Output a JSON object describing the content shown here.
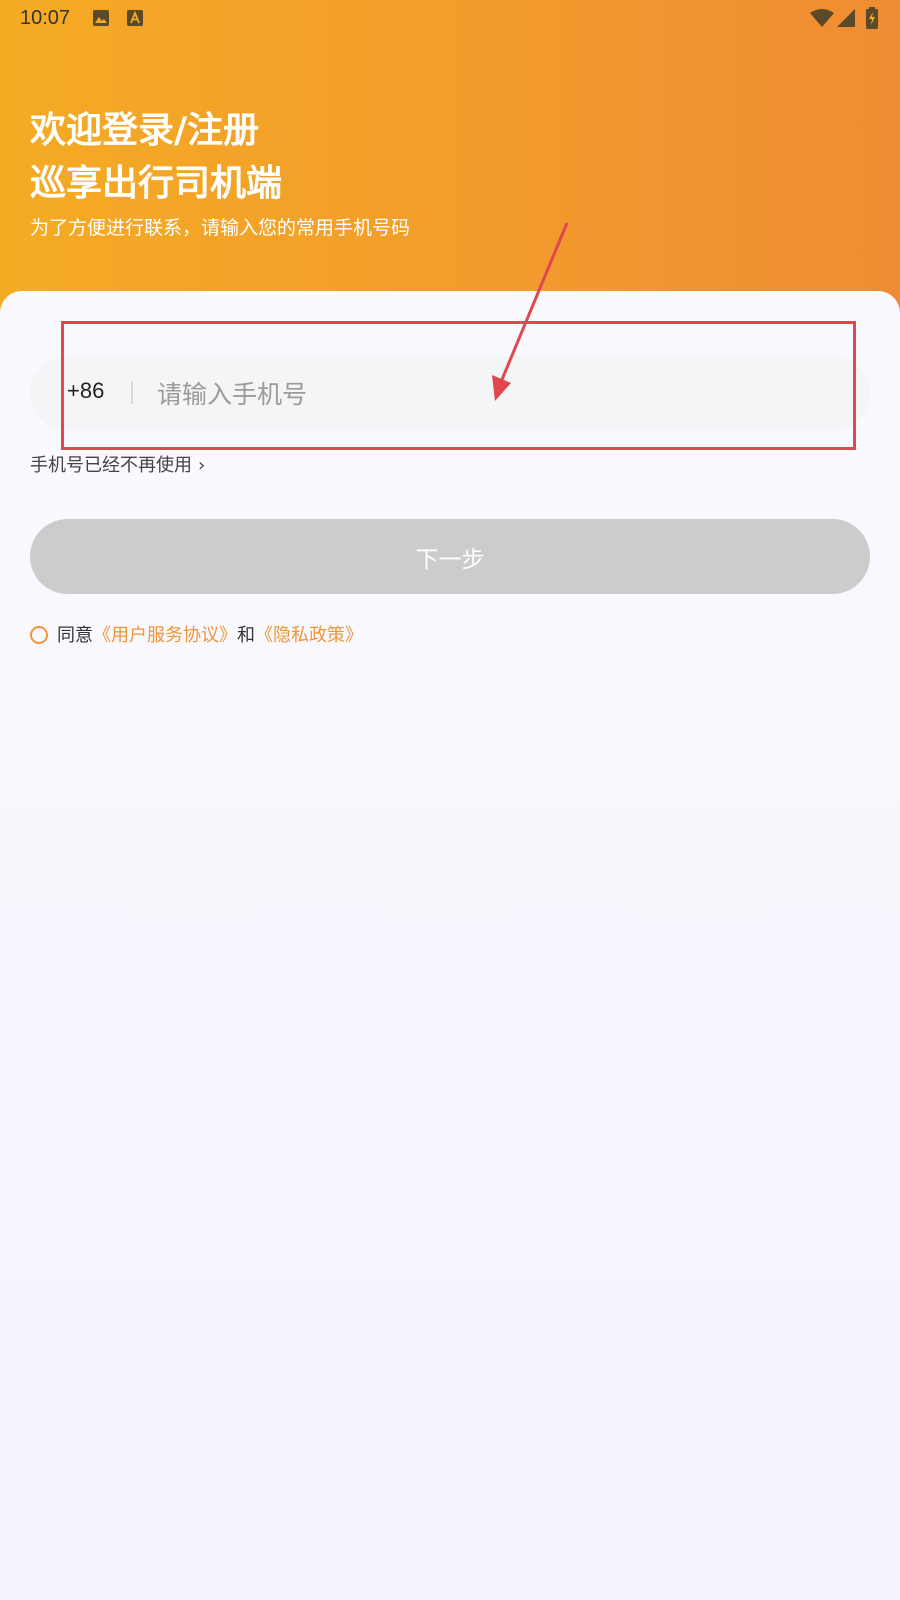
{
  "status_bar": {
    "time": "10:07",
    "icons": [
      "image-icon",
      "a-icon",
      "wifi-icon",
      "signal-icon",
      "battery-icon"
    ]
  },
  "header": {
    "title_line1": "欢迎登录/注册",
    "title_line2": "巡享出行司机端",
    "subtitle": "为了方便进行联系，请输入您的常用手机号码"
  },
  "form": {
    "country_code": "+86",
    "phone_placeholder": "请输入手机号",
    "phone_value": "",
    "old_number_link": "手机号已经不再使用",
    "next_button": "下一步"
  },
  "agreement": {
    "prefix": "同意",
    "service_link": "《用户服务协议》",
    "and": "和",
    "privacy_link": "《隐私政策》",
    "checked": false
  },
  "colors": {
    "header_start": "#f4ab23",
    "header_end": "#ef8c33",
    "accent": "#f0953a",
    "button_disabled": "#cccccc",
    "annotation": "#e0474f"
  }
}
